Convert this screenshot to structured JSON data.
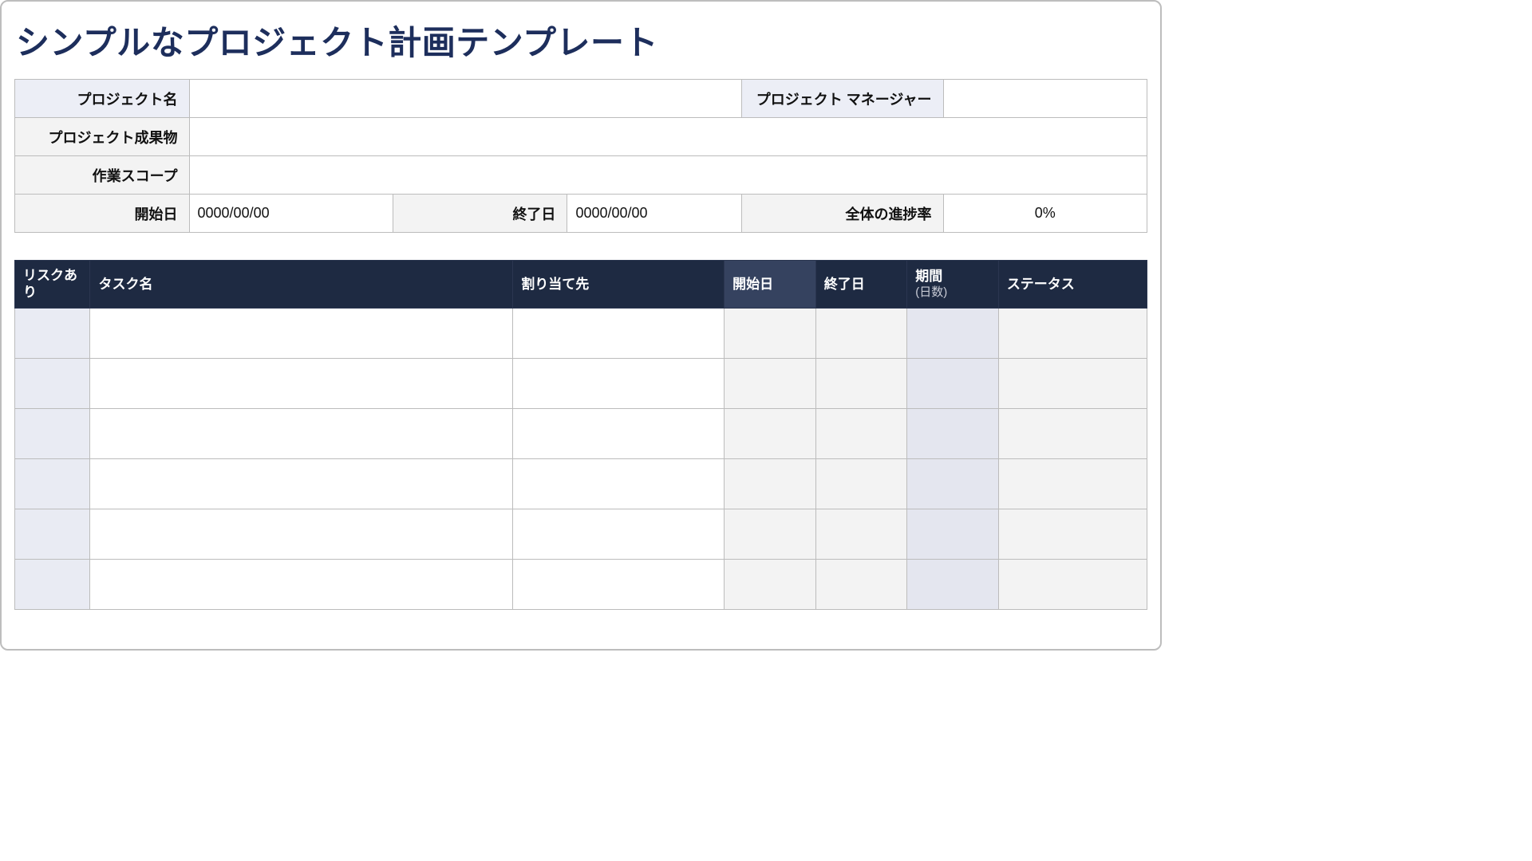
{
  "title": "シンプルなプロジェクト計画テンプレート",
  "info": {
    "labels": {
      "projectName": "プロジェクト名",
      "projectManager": "プロジェクト マネージャー",
      "deliverables": "プロジェクト成果物",
      "scope": "作業スコープ",
      "startDate": "開始日",
      "endDate": "終了日",
      "overallProgress": "全体の進捗率"
    },
    "values": {
      "projectName": "",
      "projectManager": "",
      "deliverables": "",
      "scope": "",
      "startDate": "0000/00/00",
      "endDate": "0000/00/00",
      "overallProgress": "0%"
    }
  },
  "taskTable": {
    "headers": {
      "risk": "リスクあり",
      "taskName": "タスク名",
      "assignedTo": "割り当て先",
      "startDate": "開始日",
      "endDate": "終了日",
      "duration": "期間",
      "durationSub": "(日数)",
      "status": "ステータス"
    },
    "rows": [
      {
        "risk": "",
        "taskName": "",
        "assignedTo": "",
        "startDate": "",
        "endDate": "",
        "duration": "",
        "status": ""
      },
      {
        "risk": "",
        "taskName": "",
        "assignedTo": "",
        "startDate": "",
        "endDate": "",
        "duration": "",
        "status": ""
      },
      {
        "risk": "",
        "taskName": "",
        "assignedTo": "",
        "startDate": "",
        "endDate": "",
        "duration": "",
        "status": ""
      },
      {
        "risk": "",
        "taskName": "",
        "assignedTo": "",
        "startDate": "",
        "endDate": "",
        "duration": "",
        "status": ""
      },
      {
        "risk": "",
        "taskName": "",
        "assignedTo": "",
        "startDate": "",
        "endDate": "",
        "duration": "",
        "status": ""
      },
      {
        "risk": "",
        "taskName": "",
        "assignedTo": "",
        "startDate": "",
        "endDate": "",
        "duration": "",
        "status": ""
      }
    ]
  }
}
